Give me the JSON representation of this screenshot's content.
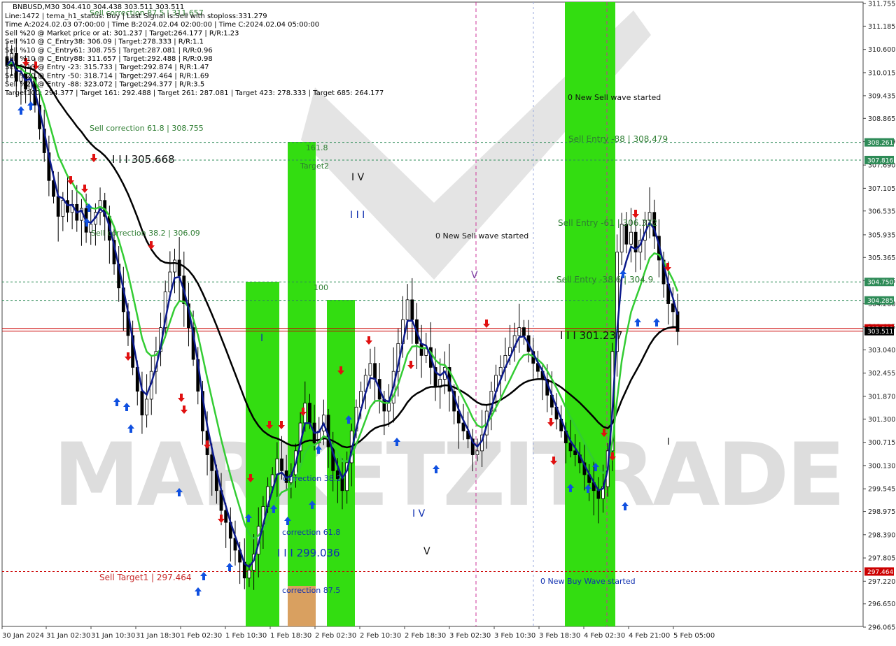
{
  "header": {
    "symbol_line": "BNBUSD,M30  304.410 304.438 303.511 303.511",
    "info_lines": [
      "Line:1472 | tema_h1_status: Buy | Last Signal is:Sell with stoploss:331.279",
      "Time A:2024.02.03 07:00:00 | Time B:2024.02.04 02:00:00 | Time C:2024.02.04 05:00:00",
      "Sell %20 @ Market price or at: 301.237 | Target:264.177 | R/R:1.23",
      "Sell %10 @ C_Entry38: 306.09 | Target:278.333 | R/R:1.1",
      "Sell %10 @ C_Entry61: 308.755 | Target:287.081 | R/R:0.96",
      "Sell %10 @ C_Entry88: 311.657 | Target:292.488 | R/R:0.98",
      "Sell %10 @ Entry -23: 315.733 | Target:292.874 | R/R:1.47",
      "Sell %20 @ Entry -50: 318.714 | Target:297.464 | R/R:1.69",
      "Sell %20 @ Entry -88: 323.072 | Target:294.377 | R/R:3.5",
      "Target100: 294.377 | Target 161: 292.488 | Target 261: 287.081 | Target 423: 278.333 | Target 685: 264.177"
    ]
  },
  "watermark": "MARKETZITRADE",
  "colors": {
    "up_candle": "#000000",
    "down_candle": "#000000",
    "ma_black": "#000000",
    "ma_navy": "#0c1a8c",
    "ma_green": "#33cc33",
    "zone_green": "#33dd11",
    "zone_orange": "#d9a060",
    "hline_green": "#2e8b57",
    "hline_red": "#cc0000",
    "arrow_up": "#1050e0",
    "arrow_down": "#e01010",
    "magenta": "#cc3399"
  },
  "price_axis": {
    "labels": [
      "311.755",
      "311.185",
      "310.600",
      "310.015",
      "309.435",
      "308.865",
      "308.279",
      "307.690",
      "307.105",
      "306.535",
      "305.935",
      "305.365",
      "304.785",
      "304.200",
      "303.625",
      "303.040",
      "302.455",
      "301.870",
      "301.300",
      "300.715",
      "300.130",
      "299.545",
      "298.975",
      "298.390",
      "297.805",
      "297.220",
      "296.650",
      "296.065"
    ],
    "badges": [
      {
        "text": "308.261",
        "value": 308.261,
        "color": "#2e8b57"
      },
      {
        "text": "307.816",
        "value": 307.816,
        "color": "#2e8b57"
      },
      {
        "text": "304.750",
        "value": 304.75,
        "color": "#2e8b57"
      },
      {
        "text": "304.285",
        "value": 304.285,
        "color": "#2e8b57"
      },
      {
        "text": "303.580",
        "value": 303.58,
        "color": "#cc0000"
      },
      {
        "text": "303.511",
        "value": 303.511,
        "color": "#000000"
      },
      {
        "text": "297.464",
        "value": 297.464,
        "color": "#cc0000"
      }
    ]
  },
  "time_axis": {
    "labels": [
      "30 Jan 2024",
      "31 Jan 02:30",
      "31 Jan 10:30",
      "31 Jan 18:30",
      "1 Feb 02:30",
      "1 Feb 10:30",
      "1 Feb 18:30",
      "2 Feb 02:30",
      "2 Feb 10:30",
      "2 Feb 18:30",
      "3 Feb 02:30",
      "3 Feb 10:30",
      "3 Feb 18:30",
      "4 Feb 02:30",
      "4 Feb 21:00",
      "5 Feb 05:00"
    ]
  },
  "annotations": {
    "sell_correction_88": "Sell correction 87.5 | 311.657",
    "sell_correction_618": "Sell correction 61.8 | 308.755",
    "sell_correction_382": "Sell correction 38.2 | 306.09",
    "iii_305": "I I I 305.668",
    "sell_target1": "Sell Target1 | 297.464",
    "iii_299": "I I I 299.036",
    "iii_301": "I I I 301.237",
    "lbl_1618": "161.8",
    "lbl_target2": "Target2",
    "lbl_100": "100",
    "wave_iv_top": "I V",
    "wave_iii_top": "I I I",
    "wave_i": "I",
    "wave_iv_bottom": "I V",
    "wave_v_bottom": "V",
    "wave_v_top": "V",
    "correction_382": "correction 38.2",
    "correction_618": "correction 61.8",
    "correction_875": "correction 87.5",
    "new_sell_wave_1": "0 New Sell wave started",
    "new_sell_wave_2": "0 New Sell wave started",
    "new_buy_wave": "0 New Buy Wave started",
    "sell_entry_88": "Sell Entry -88 | 308.479",
    "sell_entry_61": "Sell Entry -61 | 306.332",
    "sell_entry_38": "Sell Entry -38.6 | 304.9",
    "wave_i_right": "I"
  },
  "chart_data": {
    "type": "candlestick",
    "symbol": "BNBUSD",
    "timeframe": "M30",
    "ohlc_last": {
      "open": 304.41,
      "high": 304.438,
      "low": 303.511,
      "close": 303.511
    },
    "ylim": [
      296.065,
      311.755
    ],
    "horizontal_levels": [
      {
        "value": 308.261,
        "style": "dashed",
        "color": "#2e8b57"
      },
      {
        "value": 307.816,
        "style": "dashed",
        "color": "#2e8b57"
      },
      {
        "value": 304.75,
        "style": "dashed",
        "color": "#2e8b57"
      },
      {
        "value": 304.285,
        "style": "dashed",
        "color": "#2e8b57"
      },
      {
        "value": 303.58,
        "style": "solid",
        "color": "#cc0000"
      },
      {
        "value": 297.464,
        "style": "dashed",
        "color": "#cc0000"
      }
    ],
    "close_series": [
      310.2,
      310.5,
      309.8,
      310.0,
      309.6,
      309.9,
      309.2,
      308.6,
      308.0,
      307.3,
      306.9,
      306.4,
      306.8,
      306.5,
      306.7,
      306.3,
      306.6,
      306.0,
      306.2,
      306.5,
      306.8,
      306.4,
      305.8,
      305.2,
      304.6,
      304.0,
      303.4,
      302.6,
      302.0,
      301.4,
      301.8,
      302.5,
      303.0,
      303.6,
      304.5,
      305.0,
      305.3,
      304.9,
      304.2,
      303.6,
      302.8,
      302.0,
      301.0,
      300.4,
      300.0,
      299.5,
      299.0,
      298.7,
      298.3,
      298.0,
      297.7,
      297.3,
      297.5,
      297.9,
      298.6,
      299.1,
      299.6,
      299.9,
      300.3,
      300.0,
      299.7,
      299.9,
      300.5,
      301.2,
      301.7,
      301.2,
      300.7,
      301.0,
      301.4,
      300.6,
      300.0,
      299.8,
      299.5,
      300.2,
      301.0,
      301.6,
      302.0,
      302.4,
      302.7,
      302.3,
      301.8,
      301.5,
      301.7,
      302.5,
      303.2,
      303.8,
      304.3,
      303.8,
      303.2,
      302.9,
      303.1,
      302.6,
      302.1,
      302.3,
      302.6,
      302.0,
      301.5,
      301.2,
      301.0,
      300.8,
      300.4,
      300.5,
      300.9,
      301.5,
      302.0,
      302.4,
      302.6,
      302.9,
      303.1,
      303.4,
      303.6,
      303.4,
      303.0,
      302.7,
      302.5,
      302.3,
      301.9,
      301.6,
      301.3,
      301.0,
      300.7,
      300.5,
      300.4,
      300.2,
      299.9,
      299.7,
      299.5,
      299.3,
      299.6,
      300.5,
      303.0,
      305.5,
      306.2,
      305.7,
      306.0,
      305.5,
      305.8,
      306.3,
      306.5,
      305.9,
      305.3,
      304.7,
      304.2,
      304.0,
      303.5
    ]
  }
}
